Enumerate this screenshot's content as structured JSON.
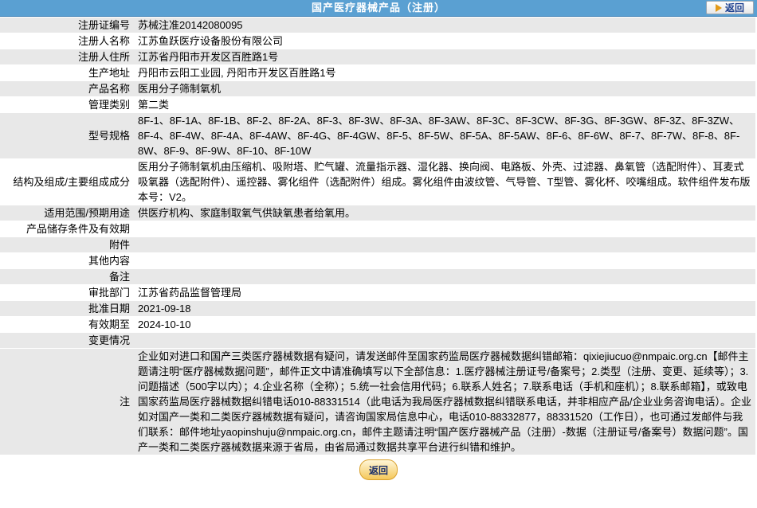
{
  "header": {
    "title": "国产医疗器械产品（注册）",
    "back_label": "返回"
  },
  "rows": [
    {
      "label": "注册证编号",
      "value": "苏械注准20142080095"
    },
    {
      "label": "注册人名称",
      "value": "江苏鱼跃医疗设备股份有限公司"
    },
    {
      "label": "注册人住所",
      "value": "江苏省丹阳市开发区百胜路1号"
    },
    {
      "label": "生产地址",
      "value": "丹阳市云阳工业园, 丹阳市开发区百胜路1号"
    },
    {
      "label": "产品名称",
      "value": "医用分子筛制氧机"
    },
    {
      "label": "管理类别",
      "value": "第二类"
    },
    {
      "label": "型号规格",
      "value": "8F-1、8F-1A、8F-1B、8F-2、8F-2A、8F-3、8F-3W、8F-3A、8F-3AW、8F-3C、8F-3CW、8F-3G、8F-3GW、8F-3Z、8F-3ZW、8F-4、8F-4W、8F-4A、8F-4AW、8F-4G、8F-4GW、8F-5、8F-5W、8F-5A、8F-5AW、8F-6、8F-6W、8F-7、8F-7W、8F-8、8F-8W、8F-9、8F-9W、8F-10、8F-10W"
    },
    {
      "label": "结构及组成/主要组成成分",
      "value": "医用分子筛制氧机由压缩机、吸附塔、贮气罐、流量指示器、湿化器、换向阀、电路板、外壳、过滤器、鼻氧管（选配附件）、耳麦式吸氧器（选配附件）、遥控器、雾化组件（选配附件）组成。雾化组件由波纹管、气导管、T型管、雾化杯、咬嘴组成。软件组件发布版本号：V2。"
    },
    {
      "label": "适用范围/预期用途",
      "value": "供医疗机构、家庭制取氧气供缺氧患者给氧用。"
    },
    {
      "label": "产品储存条件及有效期",
      "value": ""
    },
    {
      "label": "附件",
      "value": ""
    },
    {
      "label": "其他内容",
      "value": ""
    },
    {
      "label": "备注",
      "value": ""
    },
    {
      "label": "审批部门",
      "value": "江苏省药品监督管理局"
    },
    {
      "label": "批准日期",
      "value": "2021-09-18"
    },
    {
      "label": "有效期至",
      "value": "2024-10-10"
    },
    {
      "label": "变更情况",
      "value": ""
    }
  ],
  "note": {
    "label": "注",
    "text": "企业如对进口和国产三类医疗器械数据有疑问，请发送邮件至国家药监局医疗器械数据纠错邮箱：qixiejiucuo@nmpaic.org.cn【邮件主题请注明“医疗器械数据问题”，邮件正文中请准确填写以下全部信息：1.医疗器械注册证号/备案号；2.类型（注册、变更、延续等）；3.问题描述（500字以内）；4.企业名称（全称）；5.统一社会信用代码；6.联系人姓名；7.联系电话（手机和座机）；8.联系邮箱】，或致电国家药监局医疗器械数据纠错电话010-88331514（此电话为我局医疗器械数据纠错联系电话，并非相应产品/企业业务咨询电话）。企业如对国产一类和二类医疗器械数据有疑问，请咨询国家局信息中心，电话010-88332877，88331520（工作日），也可通过发邮件与我们联系：邮件地址yaopinshuju@nmpaic.org.cn，邮件主题请注明“国产医疗器械产品（注册）-数据（注册证号/备案号）数据问题”。国产一类和二类医疗器械数据来源于省局，由省局通过数据共享平台进行纠错和维护。"
  },
  "footer": {
    "back_label": "返回"
  },
  "colors": {
    "header_bg": "#5aa0d2",
    "row_alt": "#e8e8e8",
    "button_border": "#d9a12e"
  }
}
